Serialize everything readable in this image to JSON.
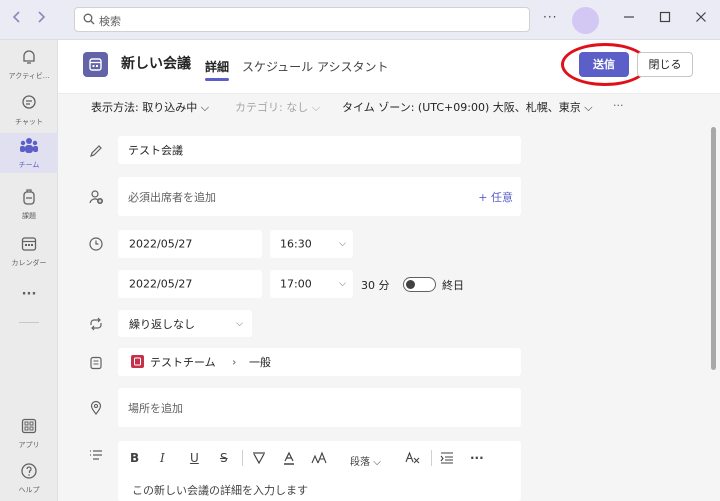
{
  "search": {
    "placeholder": "検索"
  },
  "nav": {
    "back_icon": "chevron-left-icon",
    "forward_icon": "chevron-right-icon"
  },
  "window": {
    "more_label": "···"
  },
  "rail": {
    "items": [
      {
        "label": "アクティビ..."
      },
      {
        "label": "チャット"
      },
      {
        "label": "チーム"
      },
      {
        "label": "課題"
      },
      {
        "label": "カレンダー"
      },
      {
        "label": "···"
      },
      {
        "label": "アプリ"
      },
      {
        "label": "ヘルプ"
      }
    ]
  },
  "header": {
    "title": "新しい会議",
    "tab_details": "詳細",
    "tab_scheduling": "スケジュール アシスタント",
    "send_label": "送信",
    "close_label": "閉じる"
  },
  "options": {
    "show_as": "表示方法: 取り込み中",
    "category": "カテゴリ: なし",
    "timezone": "タイム ゾーン: (UTC+09:00) 大阪、札幌、東京",
    "more": "···"
  },
  "form": {
    "title_value": "テスト会議",
    "attendees_placeholder": "必須出席者を追加",
    "optional_label": "+ 任意",
    "start_date": "2022/05/27",
    "start_time": "16:30",
    "end_date": "2022/05/27",
    "end_time": "17:00",
    "duration": "30 分",
    "allday_label": "終日",
    "repeat": "繰り返しなし",
    "channel_team": "テストチーム",
    "channel_name": "一般",
    "location_placeholder": "場所を追加",
    "details_placeholder": "この新しい会議の詳細を入力します"
  },
  "editor_toolbar": {
    "bold": "B",
    "italic": "I",
    "underline": "U",
    "strike": "S",
    "paragraph": "段落",
    "more": "···"
  },
  "colors": {
    "accent": "#5b5fc7",
    "highlight_ring": "#e0101a",
    "team_badge": "#c4314b"
  }
}
